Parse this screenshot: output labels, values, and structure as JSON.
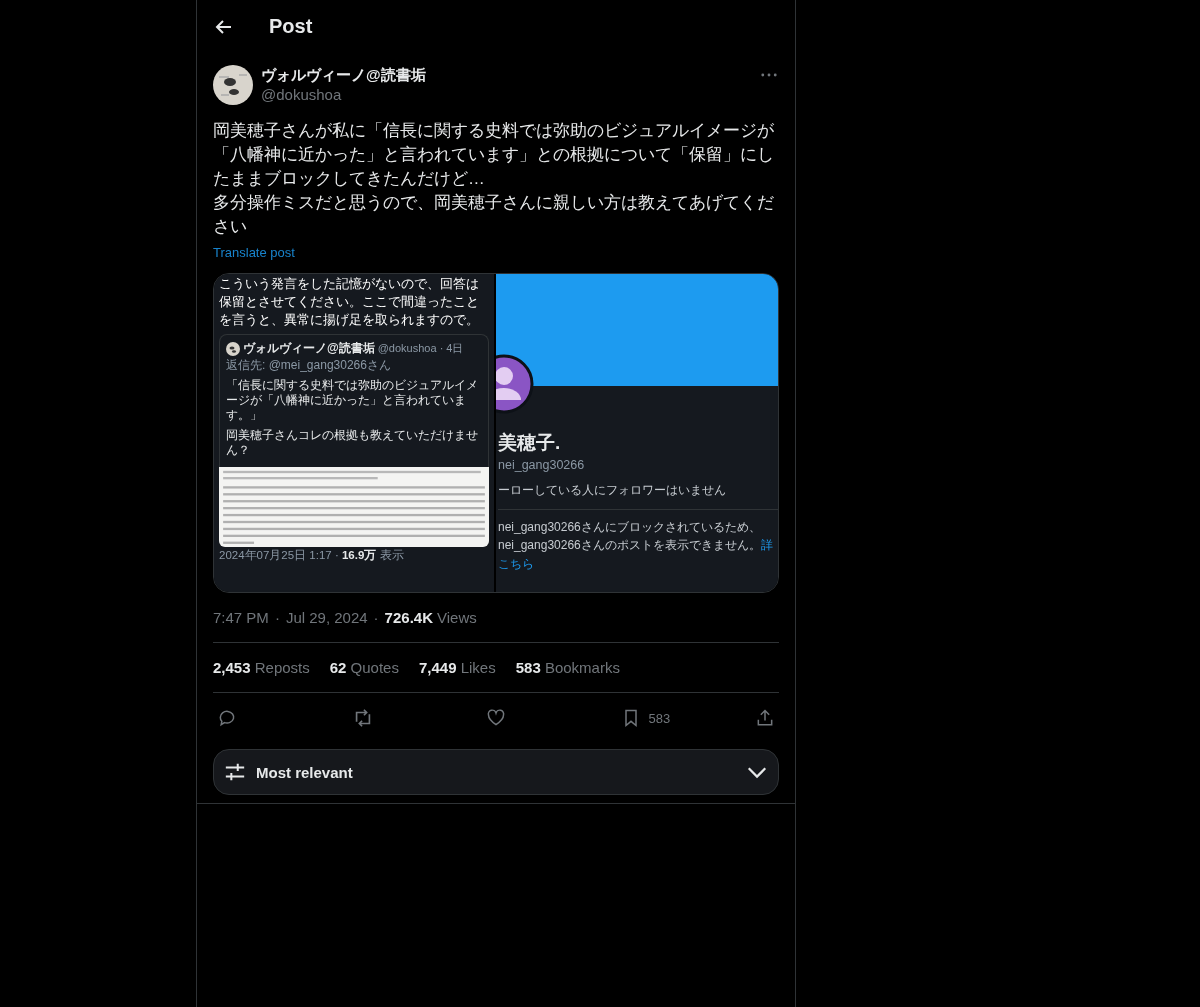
{
  "header": {
    "title": "Post"
  },
  "post": {
    "author": "ヴォルヴィーノ@読書垢",
    "handle": "@dokushoa",
    "paragraphs": [
      "岡美穂子さんが私に「信長に関する史料では弥助のビジュアルイメージが「八幡神に近かった」と言われています」との根拠について「保留」にしたままブロックしてきたんだけど…",
      "多分操作ミスだと思うので、岡美穂子さんに親しい方は教えてあげてください"
    ],
    "translate": "Translate post"
  },
  "media": {
    "left": {
      "quote": "こういう発言をした記憶がないので、回答は保留とさせてください。ここで間違ったことを言うと、異常に揚げ足を取られますので。",
      "embedded": {
        "name": "ヴォルヴィーノ@読書垢",
        "handle": "@dokushoa · 4日",
        "reply_to": "返信先: @mei_gang30266さん",
        "lines": [
          "「信長に関する史料では弥助のビジュアルイメージが「八幡神に近かった」と言われています。」",
          "岡美穂子さんコレの根拠も教えていただけません？"
        ]
      },
      "footer": "2024年07月25日 1:17 · **16.9万** 表示"
    },
    "right": {
      "name": "美穂子.",
      "handle": "nei_gang30266",
      "follow_note": "ーローしている人にフォロワーはいません",
      "blocked_lines": [
        "nei_gang30266さんにブロックされているため、",
        "nei_gang30266さんのポストを表示できません。"
      ],
      "link_a": "詳",
      "link_b": "こちら"
    }
  },
  "meta": {
    "separator": "·",
    "time": "7:47 PM",
    "date": "Jul 29, 2024",
    "views_count": "726.4K",
    "views_label": "Views"
  },
  "stats": [
    {
      "count": "2,453",
      "label": "Reposts"
    },
    {
      "count": "62",
      "label": "Quotes"
    },
    {
      "count": "7,449",
      "label": "Likes"
    },
    {
      "count": "583",
      "label": "Bookmarks"
    }
  ],
  "actions": [
    {
      "kind": "reply"
    },
    {
      "kind": "repost"
    },
    {
      "kind": "like"
    },
    {
      "kind": "bookmark",
      "count": "583"
    },
    {
      "kind": "share"
    }
  ],
  "sort": {
    "label": "Most relevant"
  }
}
